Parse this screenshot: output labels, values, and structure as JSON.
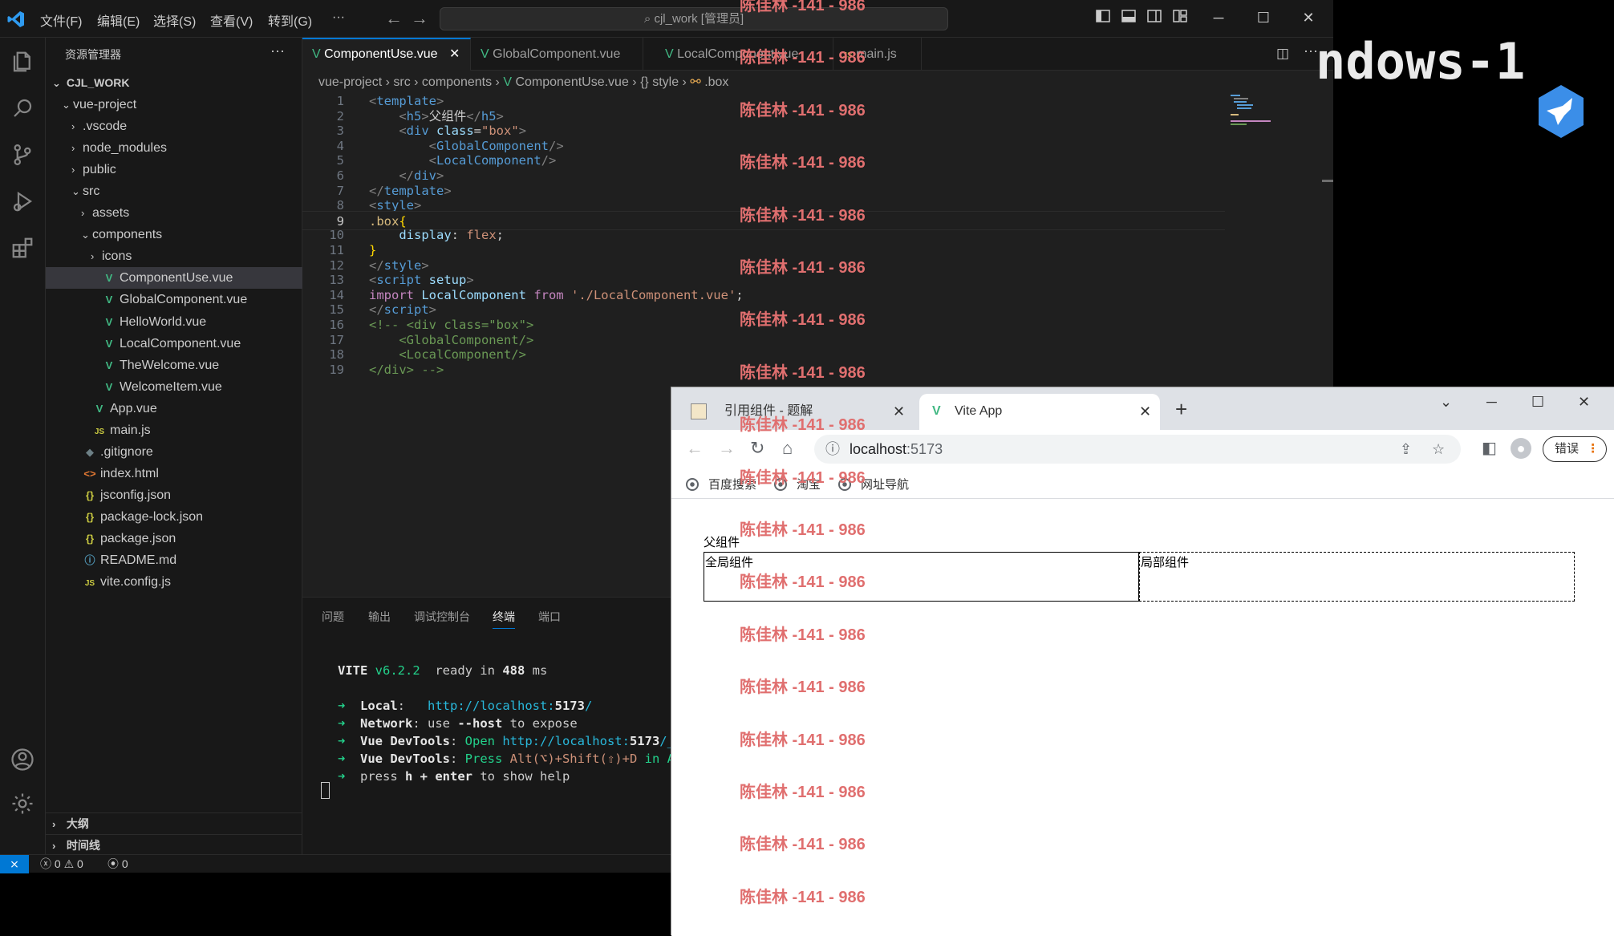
{
  "vscode": {
    "menu": [
      "文件(F)",
      "编辑(E)",
      "选择(S)",
      "查看(V)",
      "转到(G)",
      "···"
    ],
    "command_center": "cjl_work [管理员]",
    "sidebar": {
      "title": "资源管理器",
      "more": "···",
      "root": "CJL_WORK",
      "tree": [
        {
          "label": "vue-project",
          "chev": "⌄",
          "icon": "",
          "icon_type": "folder",
          "indent": 1
        },
        {
          "label": ".vscode",
          "chev": "›",
          "icon": "",
          "icon_type": "folder",
          "indent": 2
        },
        {
          "label": "node_modules",
          "chev": "›",
          "icon": "",
          "icon_type": "folder",
          "indent": 2
        },
        {
          "label": "public",
          "chev": "›",
          "icon": "",
          "icon_type": "folder",
          "indent": 2
        },
        {
          "label": "src",
          "chev": "⌄",
          "icon": "",
          "icon_type": "folder",
          "indent": 2
        },
        {
          "label": "assets",
          "chev": "›",
          "icon": "",
          "icon_type": "folder",
          "indent": 3
        },
        {
          "label": "components",
          "chev": "⌄",
          "icon": "",
          "icon_type": "folder",
          "indent": 3
        },
        {
          "label": "icons",
          "chev": "›",
          "icon": "",
          "icon_type": "folder",
          "indent": 4
        },
        {
          "label": "ComponentUse.vue",
          "chev": "",
          "icon": "V",
          "icon_type": "vue",
          "indent": 4,
          "selected": true
        },
        {
          "label": "GlobalComponent.vue",
          "chev": "",
          "icon": "V",
          "icon_type": "vue",
          "indent": 4
        },
        {
          "label": "HelloWorld.vue",
          "chev": "",
          "icon": "V",
          "icon_type": "vue",
          "indent": 4
        },
        {
          "label": "LocalComponent.vue",
          "chev": "",
          "icon": "V",
          "icon_type": "vue",
          "indent": 4
        },
        {
          "label": "TheWelcome.vue",
          "chev": "",
          "icon": "V",
          "icon_type": "vue",
          "indent": 4
        },
        {
          "label": "WelcomeItem.vue",
          "chev": "",
          "icon": "V",
          "icon_type": "vue",
          "indent": 4
        },
        {
          "label": "App.vue",
          "chev": "",
          "icon": "V",
          "icon_type": "vue",
          "indent": 3
        },
        {
          "label": "main.js",
          "chev": "",
          "icon": "JS",
          "icon_type": "js",
          "indent": 3
        },
        {
          "label": ".gitignore",
          "chev": "",
          "icon": "◆",
          "icon_type": "git",
          "indent": 2
        },
        {
          "label": "index.html",
          "chev": "",
          "icon": "<>",
          "icon_type": "html",
          "indent": 2
        },
        {
          "label": "jsconfig.json",
          "chev": "",
          "icon": "{}",
          "icon_type": "json",
          "indent": 2
        },
        {
          "label": "package-lock.json",
          "chev": "",
          "icon": "{}",
          "icon_type": "json",
          "indent": 2
        },
        {
          "label": "package.json",
          "chev": "",
          "icon": "{}",
          "icon_type": "json",
          "indent": 2
        },
        {
          "label": "README.md",
          "chev": "",
          "icon": "ⓘ",
          "icon_type": "info",
          "indent": 2
        },
        {
          "label": "vite.config.js",
          "chev": "",
          "icon": "JS",
          "icon_type": "js",
          "indent": 2
        }
      ],
      "outline": "大纲",
      "timeline": "时间线"
    },
    "tabs": [
      {
        "label": "ComponentUse.vue",
        "icon": "V",
        "active": true,
        "close": "✕"
      },
      {
        "label": "GlobalComponent.vue",
        "icon": "V"
      },
      {
        "label": "LocalComponent.vue",
        "icon": "V"
      },
      {
        "label": "main.js",
        "icon": "JS"
      }
    ],
    "breadcrumb": [
      "vue-project",
      "src",
      "components",
      "ComponentUse.vue",
      "{} style",
      ".box"
    ],
    "code_lines": [
      [
        [
          "tg",
          "<"
        ],
        [
          "tn",
          "template"
        ],
        [
          "tg",
          ">"
        ]
      ],
      [
        [
          "code",
          "    "
        ],
        [
          "tg",
          "<"
        ],
        [
          "tn",
          "h5"
        ],
        [
          "tg",
          ">"
        ],
        [
          "code",
          "父组件"
        ],
        [
          "tg",
          "</"
        ],
        [
          "tn",
          "h5"
        ],
        [
          "tg",
          ">"
        ]
      ],
      [
        [
          "code",
          "    "
        ],
        [
          "tg",
          "<"
        ],
        [
          "tn",
          "div "
        ],
        [
          "at",
          "class"
        ],
        [
          "code",
          "="
        ],
        [
          "st",
          "\"box\""
        ],
        [
          "tg",
          ">"
        ]
      ],
      [
        [
          "code",
          "        "
        ],
        [
          "tg",
          "<"
        ],
        [
          "tn",
          "GlobalComponent"
        ],
        [
          "tg",
          "/>"
        ]
      ],
      [
        [
          "code",
          "        "
        ],
        [
          "tg",
          "<"
        ],
        [
          "tn",
          "LocalComponent"
        ],
        [
          "tg",
          "/>"
        ]
      ],
      [
        [
          "code",
          "    "
        ],
        [
          "tg",
          "</"
        ],
        [
          "tn",
          "div"
        ],
        [
          "tg",
          ">"
        ]
      ],
      [
        [
          "tg",
          "</"
        ],
        [
          "tn",
          "template"
        ],
        [
          "tg",
          ">"
        ]
      ],
      [
        [
          "tg",
          "<"
        ],
        [
          "tn",
          "style"
        ],
        [
          "tg",
          ">"
        ]
      ],
      [
        [
          "sel-c",
          ".box"
        ],
        [
          "bc",
          "{"
        ]
      ],
      [
        [
          "code",
          "    "
        ],
        [
          "prop",
          "display"
        ],
        [
          "code",
          ": "
        ],
        [
          "val",
          "flex"
        ],
        [
          "code",
          ";"
        ]
      ],
      [
        [
          "bc",
          "}"
        ]
      ],
      [
        [
          "tg",
          "</"
        ],
        [
          "tn",
          "style"
        ],
        [
          "tg",
          ">"
        ]
      ],
      [
        [
          "tg",
          "<"
        ],
        [
          "tn",
          "script "
        ],
        [
          "at",
          "setup"
        ],
        [
          "tg",
          ">"
        ]
      ],
      [
        [
          "kw",
          "import "
        ],
        [
          "vn",
          "LocalComponent "
        ],
        [
          "kw",
          "from "
        ],
        [
          "st",
          "'./LocalComponent.vue'"
        ],
        [
          "code",
          ";"
        ]
      ],
      [
        [
          "tg",
          "</"
        ],
        [
          "tn",
          "script"
        ],
        [
          "tg",
          ">"
        ]
      ],
      [
        [
          "cm",
          "<!-- <div class=\"box\">"
        ]
      ],
      [
        [
          "cm",
          "    <GlobalComponent/>"
        ]
      ],
      [
        [
          "cm",
          "    <LocalComponent/>"
        ]
      ],
      [
        [
          "cm",
          "</div> -->"
        ]
      ]
    ],
    "current_line": 9,
    "panel_tabs": [
      "问题",
      "输出",
      "调试控制台",
      "终端",
      "端口"
    ],
    "active_panel_tab": "终端",
    "terminal": {
      "vite": "VITE",
      "version": " v6.2.2",
      "ready": "  ready in ",
      "ms": "488",
      "ms_unit": " ms",
      "lines": [
        [
          [
            "green",
            "➜  "
          ],
          [
            "bold",
            "Local"
          ],
          [
            "code",
            ":   "
          ],
          [
            "cyan",
            "http://localhost:"
          ],
          [
            "cyan bold",
            "5173"
          ],
          [
            "cyan",
            "/"
          ]
        ],
        [
          [
            "green",
            "➜  "
          ],
          [
            "bold",
            "Network"
          ],
          [
            "code",
            ": use "
          ],
          [
            "bold",
            "--host"
          ],
          [
            "code",
            " to expose"
          ]
        ],
        [
          [
            "green",
            "➜  "
          ],
          [
            "bold",
            "Vue DevTools"
          ],
          [
            "code",
            ": "
          ],
          [
            "green",
            "Open "
          ],
          [
            "cyan",
            "http://localhost:"
          ],
          [
            "cyan bold",
            "5173"
          ],
          [
            "cyan",
            "/__"
          ]
        ],
        [
          [
            "green",
            "➜  "
          ],
          [
            "bold",
            "Vue DevTools"
          ],
          [
            "code",
            ": "
          ],
          [
            "green",
            "Press "
          ],
          [
            "st",
            "Alt(⌥)+Shift(⇧)+D"
          ],
          [
            "green",
            " in Ap"
          ]
        ],
        [
          [
            "green",
            "➜  "
          ],
          [
            "code",
            "press "
          ],
          [
            "bold",
            "h + enter"
          ],
          [
            "code",
            " to show help"
          ]
        ]
      ]
    },
    "status": {
      "remote": "⨯",
      "errors": "0",
      "warnings": "0",
      "ports": "0"
    }
  },
  "desktop": {
    "text": "ndows-1"
  },
  "browser": {
    "tabs": [
      {
        "label": "引用组件 - 题解",
        "close": "✕"
      },
      {
        "label": "Vite App",
        "close": "✕",
        "active": true
      }
    ],
    "new_tab": "+",
    "url_host": "localhost",
    "url_port": ":5173",
    "error_button": "错误",
    "bookmarks": [
      "百度搜索",
      "淘宝",
      "网址导航"
    ],
    "page": {
      "heading": "父组件",
      "global": "全局组件",
      "local": "局部组件"
    }
  },
  "watermark": {
    "text": "陈佳林 -141 - 986",
    "color": "#e06f6f"
  }
}
